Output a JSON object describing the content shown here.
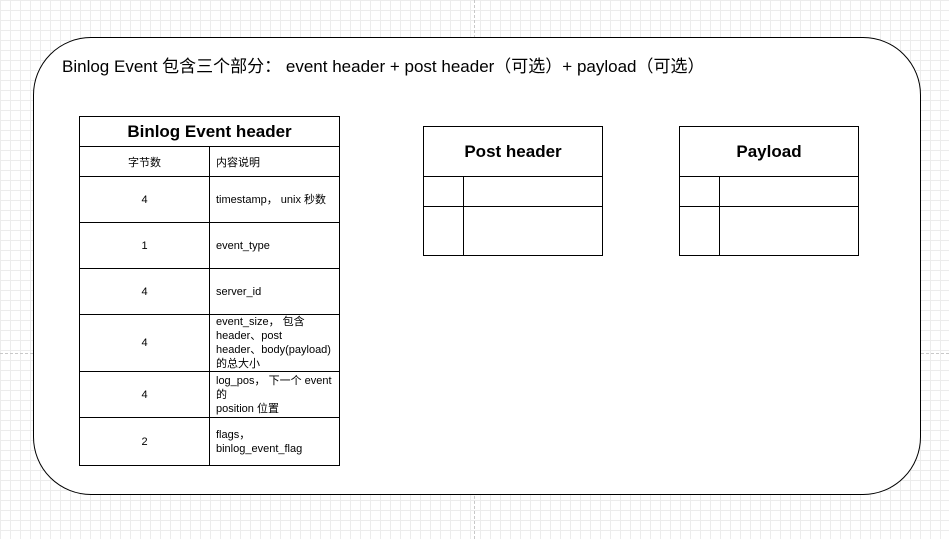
{
  "diagram": {
    "title": "Binlog Event 包含三个部分： event header  +  post header（可选）+  payload（可选）",
    "event_header": {
      "title": "Binlog Event header",
      "columns": [
        "字节数",
        "内容说明"
      ],
      "rows": [
        {
          "size": "4",
          "desc_lines": [
            "timestamp， unix 秒数"
          ]
        },
        {
          "size": "1",
          "desc_lines": [
            "event_type"
          ]
        },
        {
          "size": "4",
          "desc_lines": [
            "server_id"
          ]
        },
        {
          "size": "4",
          "desc_lines": [
            "event_size， 包含 header、post",
            "header、body(payload) 的总大小"
          ]
        },
        {
          "size": "4",
          "desc_lines": [
            "log_pos， 下一个 event 的",
            "position 位置"
          ]
        },
        {
          "size": "2",
          "desc_lines": [
            "flags， binlog_event_flag"
          ]
        }
      ]
    },
    "post_header": {
      "title": "Post header"
    },
    "payload": {
      "title": "Payload"
    }
  }
}
